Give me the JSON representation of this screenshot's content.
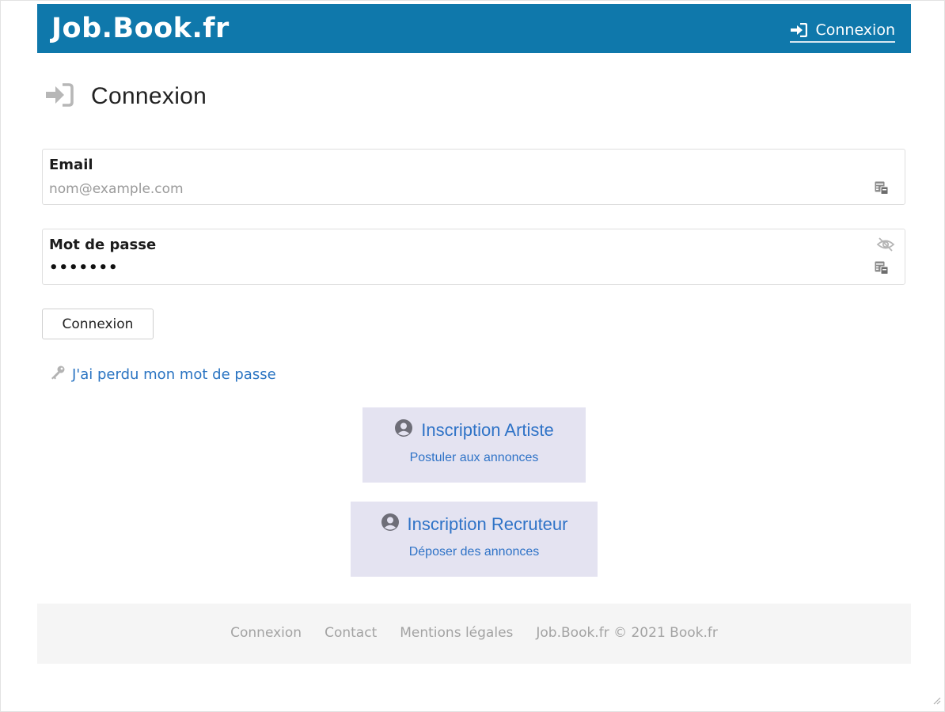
{
  "header": {
    "brand": "Job.Book.fr",
    "login_label": "Connexion"
  },
  "page": {
    "title": "Connexion"
  },
  "form": {
    "email": {
      "label": "Email",
      "placeholder": "nom@example.com",
      "value": ""
    },
    "password": {
      "label": "Mot de passe",
      "masked_value": "•••••••"
    },
    "submit_label": "Connexion",
    "lost_password_label": "J'ai perdu mon mot de passe"
  },
  "signup": [
    {
      "title": "Inscription Artiste",
      "subtitle": "Postuler aux annonces"
    },
    {
      "title": "Inscription Recruteur",
      "subtitle": "Déposer des annonces"
    }
  ],
  "footer": {
    "links": [
      "Connexion",
      "Contact",
      "Mentions légales"
    ],
    "copyright": "Job.Book.fr © 2021 Book.fr"
  },
  "colors": {
    "header_bg": "#0f78ab",
    "link": "#2a74c2",
    "card_bg": "#e4e3f1",
    "footer_bg": "#f5f5f5"
  },
  "icons": {
    "login": "sign-in-icon",
    "autofill": "autofill-card-icon",
    "password_toggle": "eye-slash-icon",
    "lost_password": "key-icon",
    "signup": "user-circle-icon"
  }
}
